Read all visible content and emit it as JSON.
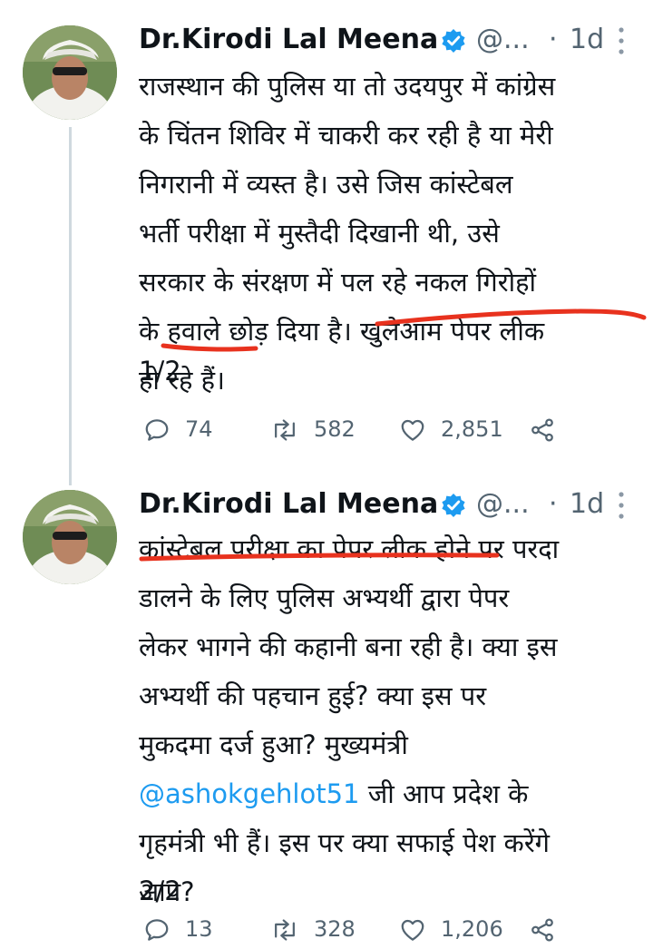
{
  "tweets": [
    {
      "author": {
        "display_name": "Dr.Kirodi Lal Meena",
        "handle": "@...",
        "verified": true
      },
      "time_separator": "·",
      "time": "1d",
      "text_lines": [
        "राजस्थान की पुलिस या तो उदयपुर में कांग्रेस",
        "के चिंतन शिविर में चाकरी कर रही है या मेरी",
        "निगरानी में व्यस्त है। उसे जिस कांस्टेबल",
        "भर्ती परीक्षा में मुस्तैदी दिखानी थी, उसे",
        "सरकार के संरक्षण में पल रहे नकल गिरोहों",
        "के हवाले छोड़ दिया है। खुलेआम पेपर लीक",
        "हो रहे हैं।"
      ],
      "numbering": "1/2",
      "replies": "74",
      "retweets": "582",
      "likes": "2,851"
    },
    {
      "author": {
        "display_name": "Dr.Kirodi Lal Meena",
        "handle": "@...",
        "verified": true
      },
      "time_separator": "·",
      "time": "1d",
      "text_lines": [
        "कांस्टेबल परीक्षा का पेपर लीक होने पर परदा",
        "डालने के लिए पुलिस अभ्यर्थी द्वारा पेपर",
        "लेकर भागने की कहानी बना रही है। क्या इस",
        "अभ्यर्थी की पहचान हुई? क्या इस पर",
        "मुकदमा दर्ज हुआ? मुख्यमंत्री"
      ],
      "mention": "@ashokgehlot51",
      "mention_suffix": " जी आप प्रदेश के",
      "text_lines_after": [
        "गृहमंत्री भी हैं। इस पर क्या सफाई पेश करेंगे",
        "आप?"
      ],
      "numbering": "2/2",
      "replies": "13",
      "retweets": "328",
      "likes": "1,206"
    }
  ],
  "icons": {
    "verified": "verified-badge-icon",
    "more": "more-vertical-icon",
    "reply": "reply-icon",
    "retweet": "retweet-icon",
    "like": "heart-icon",
    "share": "share-icon"
  },
  "colors": {
    "text": "#0f1419",
    "muted": "#536471",
    "accent": "#1d9bf0",
    "annotation": "#e8321e",
    "thread_line": "#cfd9de"
  }
}
